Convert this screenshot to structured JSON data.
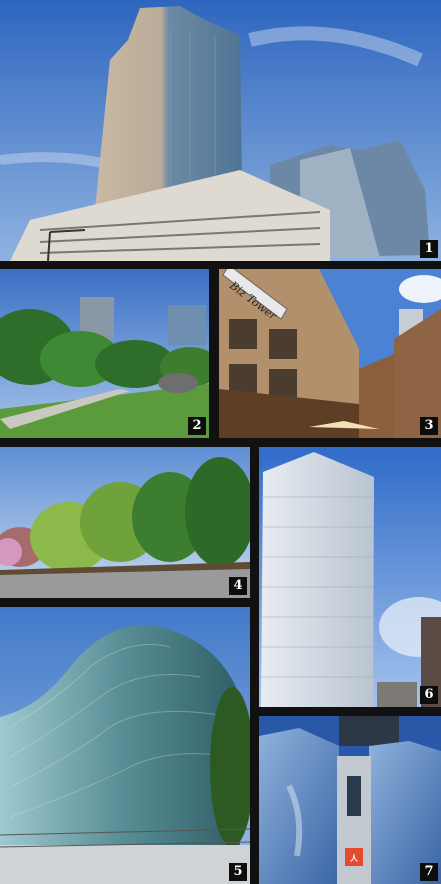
{
  "collage": {
    "photos": [
      {
        "label": "1"
      },
      {
        "label": "2"
      },
      {
        "label": "3",
        "sign_text": "Biz Tower"
      },
      {
        "label": "4"
      },
      {
        "label": "5"
      },
      {
        "label": "6"
      },
      {
        "label": "7",
        "logo_mark": "人"
      }
    ]
  },
  "colors": {
    "sky": "#3f74c6",
    "grass": "#5b9b3c",
    "glass": "#6fa3a8",
    "frame": "#111111"
  }
}
